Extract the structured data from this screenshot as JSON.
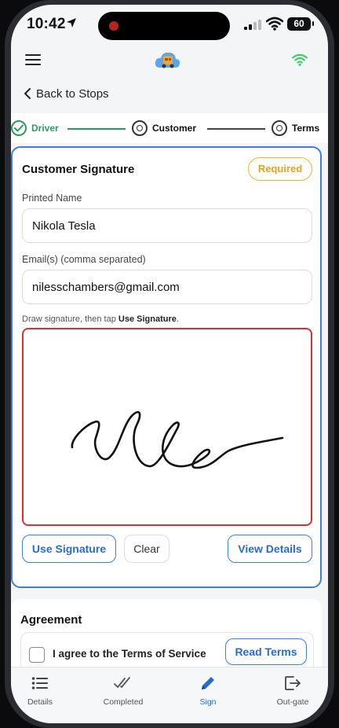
{
  "status_bar": {
    "time": "10:42",
    "battery": "60"
  },
  "nav": {
    "back_label": "Back to Stops"
  },
  "stepper": {
    "steps": [
      {
        "label": "Driver",
        "state": "done"
      },
      {
        "label": "Customer",
        "state": "pending"
      },
      {
        "label": "Terms",
        "state": "pending"
      }
    ]
  },
  "signature_card": {
    "title": "Customer Signature",
    "required_badge": "Required",
    "printed_name_label": "Printed Name",
    "printed_name_value": "Nikola Tesla",
    "emails_label": "Email(s) (comma separated)",
    "emails_value": "nilesschambers@gmail.com",
    "hint_prefix": "Draw signature, then tap ",
    "hint_action": "Use Signature",
    "hint_suffix": ".",
    "use_signature_button": "Use Signature",
    "clear_button": "Clear",
    "view_details_button": "View Details"
  },
  "agreement": {
    "title": "Agreement",
    "checkbox_label": "I agree to the Terms of Service",
    "checked": false,
    "read_terms_button": "Read Terms"
  },
  "tab_bar": {
    "tabs": [
      {
        "label": "Details",
        "icon": "list-icon",
        "active": false
      },
      {
        "label": "Completed",
        "icon": "double-check-icon",
        "active": false
      },
      {
        "label": "Sign",
        "icon": "pencil-icon",
        "active": true
      },
      {
        "label": "Out-gate",
        "icon": "exit-icon",
        "active": false
      }
    ]
  },
  "colors": {
    "accent": "#2a6bd1",
    "done_green": "#2e9b5e",
    "required_amber": "#e1a31c",
    "signature_border": "#d93030",
    "connection_green": "#3ecf6a"
  }
}
